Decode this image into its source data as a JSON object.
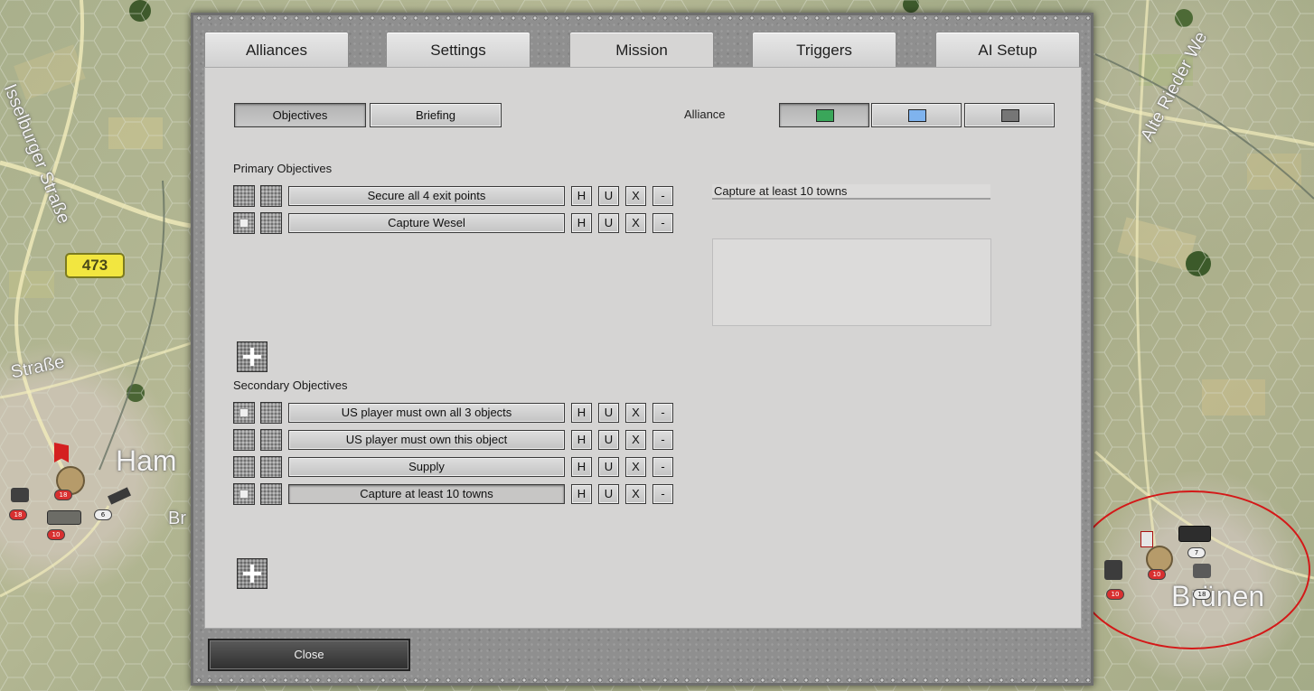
{
  "map": {
    "labels": {
      "street_1": "Isselburger Straße",
      "street_2": "Alte Rieder We",
      "street_3": "Straße",
      "town_1": "Ham",
      "town_1_suffix": "Br",
      "town_2": "Brünen",
      "road_number": "473"
    },
    "badges": {
      "b1": "18",
      "b2": "18",
      "b3": "6",
      "b4": "10",
      "b5": "7",
      "b6": "10",
      "b7": "18",
      "b8": "10"
    },
    "colors": {
      "highlight_ring": "#d41818",
      "road_sign": "#f2e640"
    }
  },
  "tabs": [
    {
      "label": "Alliances",
      "active": false
    },
    {
      "label": "Settings",
      "active": false
    },
    {
      "label": "Mission",
      "active": true
    },
    {
      "label": "Triggers",
      "active": false
    },
    {
      "label": "AI Setup",
      "active": false
    }
  ],
  "mission": {
    "sub_tabs": [
      {
        "label": "Objectives",
        "active": true
      },
      {
        "label": "Briefing",
        "active": false
      }
    ],
    "alliance_label": "Alliance",
    "alliance_swatches": [
      {
        "color": "#3aa65a",
        "selected": true
      },
      {
        "color": "#7fb3ee",
        "selected": false
      },
      {
        "color": "#767676",
        "selected": false
      }
    ],
    "primary_label": "Primary Objectives",
    "primary": [
      {
        "name": "Secure all 4 exit points",
        "checked": false,
        "selected": false
      },
      {
        "name": "Capture Wesel",
        "checked": true,
        "selected": false
      }
    ],
    "secondary_label": "Secondary Objectives",
    "secondary": [
      {
        "name": "US player must own all 3 objects",
        "checked": true,
        "selected": false
      },
      {
        "name": "US player must own this object",
        "checked": false,
        "selected": false
      },
      {
        "name": "Supply",
        "checked": false,
        "selected": false
      },
      {
        "name": "Capture at least 10 towns",
        "checked": true,
        "selected": true
      }
    ],
    "row_buttons": {
      "h": "H",
      "u": "U",
      "x": "X",
      "remove": "-"
    },
    "objective_text": "Capture at least 10 towns",
    "objective_description": ""
  },
  "footer": {
    "close_label": "Close"
  }
}
